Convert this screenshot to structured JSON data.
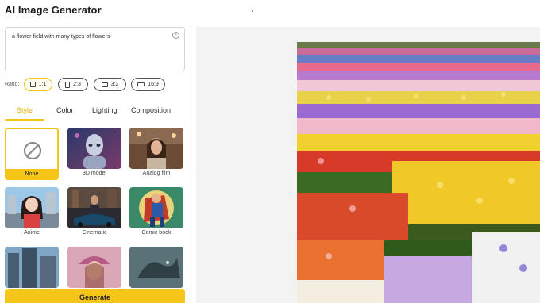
{
  "app": {
    "title": "AI Image Generator"
  },
  "prompt": {
    "value": "a flower field with many types of flowers",
    "clear_icon": "close-circle-icon"
  },
  "ratio": {
    "label": "Ratio:",
    "options": [
      {
        "label": "1:1",
        "icon": "square-icon",
        "selected": true
      },
      {
        "label": "2:3",
        "icon": "portrait-icon",
        "selected": false
      },
      {
        "label": "3:2",
        "icon": "landscape-icon",
        "selected": false
      },
      {
        "label": "16:9",
        "icon": "wide-icon",
        "selected": false
      }
    ]
  },
  "tabs": [
    {
      "label": "Style",
      "active": true
    },
    {
      "label": "Color",
      "active": false
    },
    {
      "label": "Lighting",
      "active": false
    },
    {
      "label": "Composition",
      "active": false
    }
  ],
  "styles": [
    {
      "label": "None",
      "selected": true,
      "icon": "none-icon"
    },
    {
      "label": "3D model",
      "selected": false
    },
    {
      "label": "Analog film",
      "selected": false
    },
    {
      "label": "Anime",
      "selected": false
    },
    {
      "label": "Cinematic",
      "selected": false
    },
    {
      "label": "Comic book",
      "selected": false
    },
    {
      "label": "",
      "selected": false
    },
    {
      "label": "",
      "selected": false
    },
    {
      "label": "",
      "selected": false
    }
  ],
  "generate": {
    "label": "Generate"
  },
  "colors": {
    "accent": "#f5c518",
    "canvas": "#f3f3f3"
  }
}
